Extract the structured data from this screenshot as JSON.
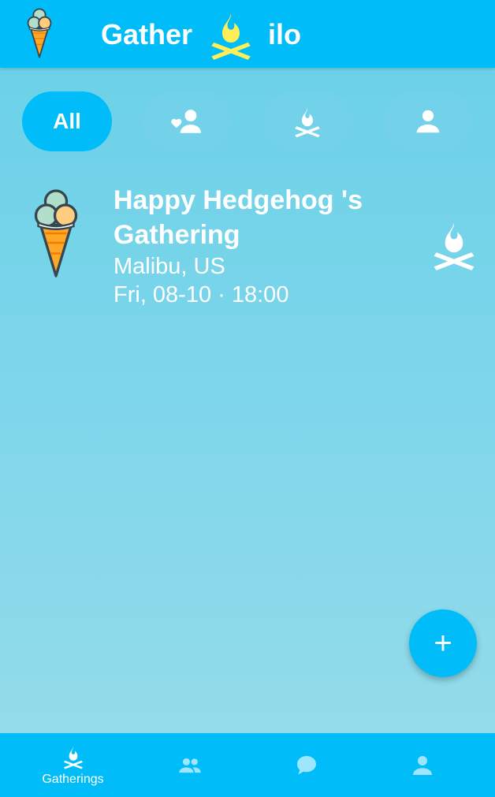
{
  "app": {
    "title_left": "Gather",
    "title_right": "ilo",
    "logo_icon": "ice-cream-icon",
    "title_icon": "campfire-icon",
    "colors": {
      "primary": "#00bdf9",
      "fire_accent": "#ffee58",
      "background": "#7fd6ea"
    }
  },
  "filters": [
    {
      "label": "All",
      "active": true
    },
    {
      "icon": "favorite-person-icon",
      "active": false
    },
    {
      "icon": "campfire-icon",
      "active": false
    },
    {
      "icon": "person-icon",
      "active": false
    }
  ],
  "gatherings": [
    {
      "title": "Happy Hedgehog 's Gathering",
      "location": "Malibu, US",
      "datetime": "Fri, 08-10 · 18:00",
      "avatar_icon": "ice-cream-icon",
      "type_icon": "campfire-icon"
    }
  ],
  "fab": {
    "label": "+"
  },
  "bottom_nav": [
    {
      "label": "Gatherings",
      "icon": "campfire-icon",
      "active": true
    },
    {
      "label": "",
      "icon": "people-icon",
      "active": false
    },
    {
      "label": "",
      "icon": "chat-icon",
      "active": false
    },
    {
      "label": "",
      "icon": "person-icon",
      "active": false
    }
  ]
}
